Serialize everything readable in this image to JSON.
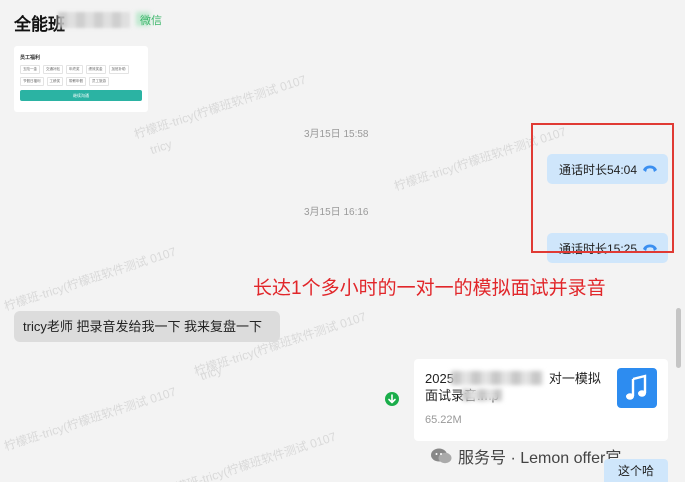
{
  "header": {
    "title": "全能班",
    "tag": "微信"
  },
  "card": {
    "title": "员工福利",
    "chips": [
      "五险一金",
      "交通补贴",
      "年终奖",
      "绩效奖金",
      "加班补助",
      "节假日福利",
      "工龄奖",
      "带薪年假",
      "员工旅游"
    ],
    "button": "继续沟通"
  },
  "messages": {
    "timestamp_1": "3月15日 15:58",
    "timestamp_2": "3月15日 16:16",
    "call_1": "通话时长54:04",
    "call_2": "通话时长15:25",
    "annotation": "长达1个多小时的一对一的模拟面试并录音",
    "left_text": "tricy老师 把录音发给我一下 我来复盘一下",
    "file_name_line1": "2025",
    "file_name_line1_end": "对一模拟",
    "file_name_line2": "面试录音.mp",
    "file_size": "65.22M",
    "last_bubble": "这个哈"
  },
  "watermark": {
    "text": "柠檬班-tricy(柠檬班软件测试 0107",
    "sub": "tricy"
  },
  "footer": {
    "label": "服务号 · Lemon offer官"
  },
  "colors": {
    "accent_green": "#1aad4a",
    "bubble_blue": "#cfe6fb",
    "annotation_red": "#e1262a",
    "music_blue": "#2d8cf0"
  }
}
